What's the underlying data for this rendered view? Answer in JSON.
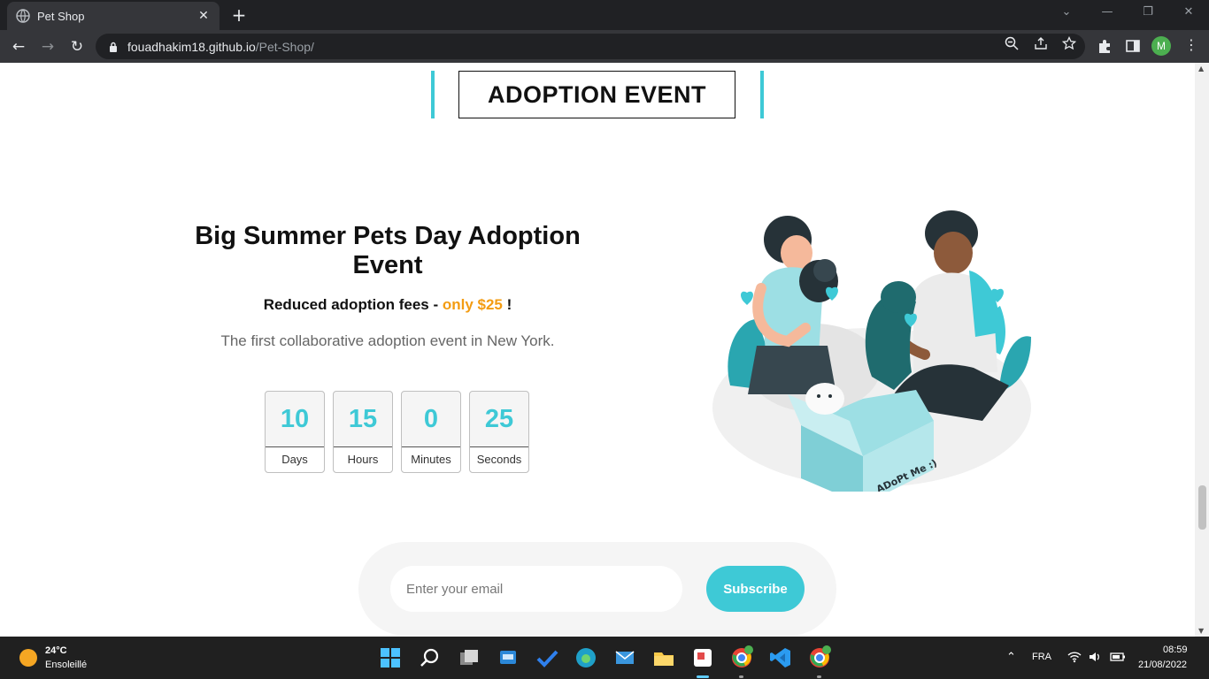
{
  "browser": {
    "tab_title": "Pet Shop",
    "url_host": "fouadhakim18.github.io",
    "url_path": "/Pet-Shop/",
    "profile_initial": "M"
  },
  "page": {
    "section_title": "ADOPTION EVENT",
    "headline": "Big Summer Pets Day Adoption Event",
    "fees_prefix": "Reduced adoption fees - ",
    "fees_accent": "only $25",
    "fees_suffix": " !",
    "description": "The first collaborative adoption event in New York.",
    "countdown": [
      {
        "value": "10",
        "label": "Days"
      },
      {
        "value": "15",
        "label": "Hours"
      },
      {
        "value": "0",
        "label": "Minutes"
      },
      {
        "value": "25",
        "label": "Seconds"
      }
    ],
    "email_placeholder": "Enter your email",
    "subscribe_label": "Subscribe",
    "illustration_text": "ADoPt Me :)"
  },
  "colors": {
    "accent": "#3ec9d6",
    "price": "#f39c12"
  },
  "taskbar": {
    "temperature": "24°C",
    "weather": "Ensoleillé",
    "language": "FRA",
    "time": "08:59",
    "date": "21/08/2022"
  }
}
